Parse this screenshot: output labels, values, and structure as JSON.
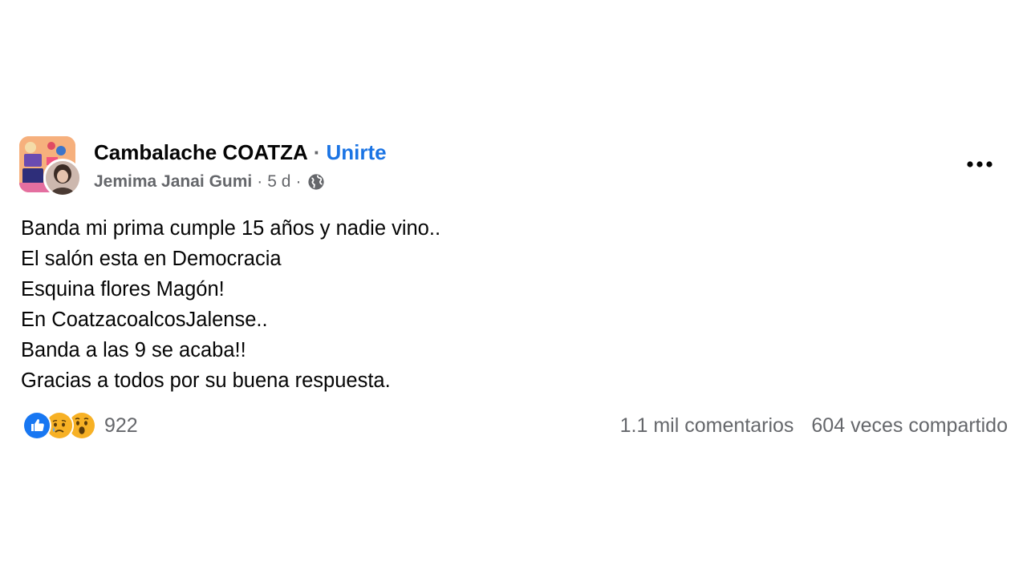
{
  "header": {
    "group_name": "Cambalache COATZA",
    "separator": "·",
    "join_label": "Unirte",
    "author": "Jemima Janai Gumi",
    "time": "5 d",
    "meta_separator": "·",
    "privacy_icon": "globe-icon",
    "more_icon": "more-horizontal-icon"
  },
  "post": {
    "lines": [
      "Banda mi prima cumple 15 años y nadie vino..",
      "El salón esta en Democracia",
      "Esquina flores Magón!",
      "En CoatzacoalcosJalense..",
      "Banda a las 9 se acaba!!",
      "Gracias a todos por su buena respuesta."
    ]
  },
  "footer": {
    "reactions": [
      "like-icon",
      "sad-icon",
      "wow-icon"
    ],
    "reaction_count": "922",
    "comments": "1.1 mil comentarios",
    "shares": "604 veces compartido"
  },
  "colors": {
    "link": "#1b74e4",
    "secondary_text": "#65676b",
    "primary_text": "#050505",
    "like_blue": "#1877f2",
    "emoji_yellow": "#f7b125"
  }
}
